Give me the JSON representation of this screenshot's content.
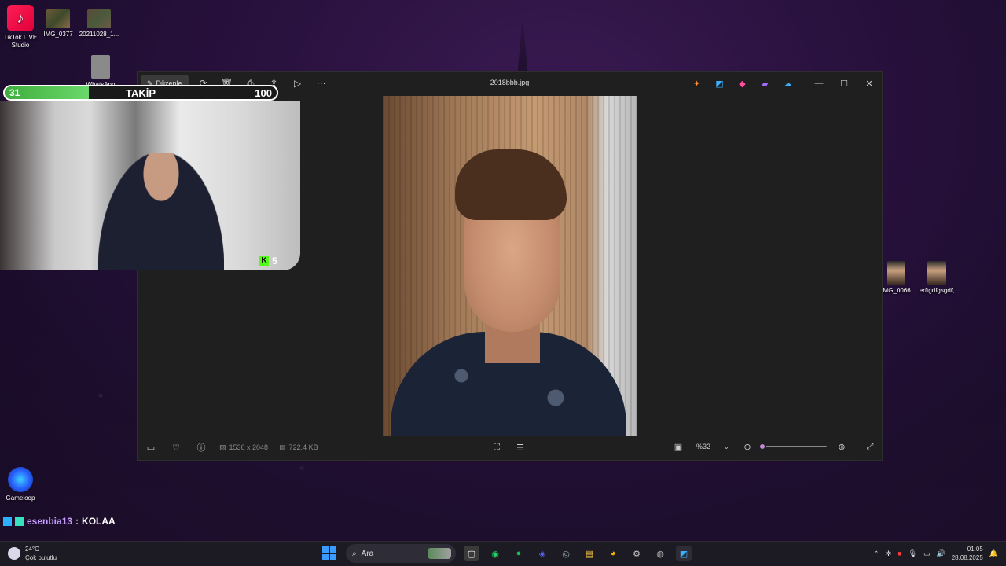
{
  "desktop": {
    "icons": [
      {
        "label": "TikTok LIVE Studio"
      },
      {
        "label": "IMG_0377"
      },
      {
        "label": "20211028_1..."
      },
      {
        "label": "WhatsApp Görsel 2025..."
      },
      {
        "label": "Gameloop"
      },
      {
        "label": "IMG_0066"
      },
      {
        "label": "erftgdfgsgdf,"
      }
    ]
  },
  "overlay": {
    "follow_current": "31",
    "follow_label": "TAKİP",
    "follow_goal": "100",
    "follow_progress": 0.31,
    "kick_viewers": "5"
  },
  "viewer": {
    "edit_label": "Düzenle",
    "file_name": "2018bbb.jpg",
    "dimensions": "1536 x 2048",
    "file_size": "722.4 KB",
    "zoom_value": "%32",
    "zoom_fraction": 0.0
  },
  "chat": {
    "user": "esenbia13",
    "separator": ":",
    "message": "KOLAA"
  },
  "taskbar": {
    "weather_temp": "24°C",
    "weather_desc": "Çok bulutlu",
    "search_placeholder": "Ara",
    "time": "01:05",
    "date": "28.08.2025"
  },
  "colors": {
    "accent": "#c38ad8",
    "progress": "#6ad86a",
    "chat_user": "#c49cff"
  }
}
